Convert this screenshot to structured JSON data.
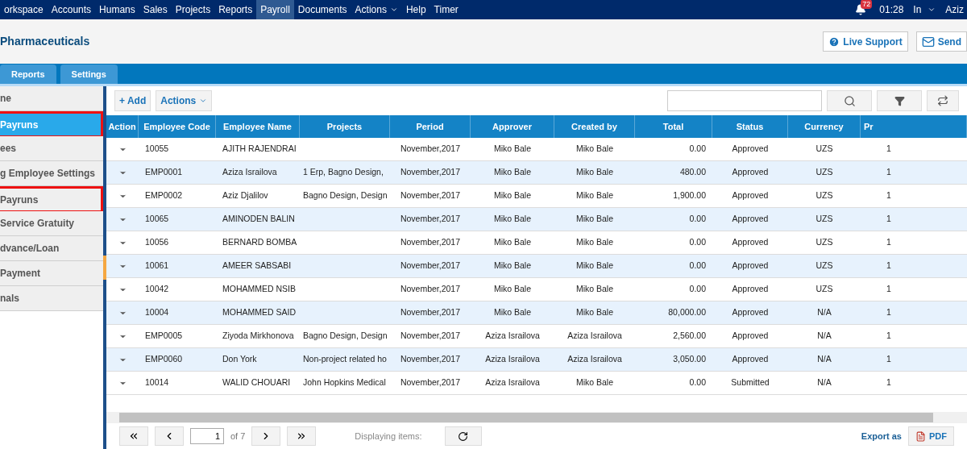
{
  "nav": {
    "items": [
      {
        "label": "orkspace",
        "selected": false
      },
      {
        "label": "Accounts",
        "selected": false
      },
      {
        "label": "Humans",
        "selected": false
      },
      {
        "label": "Sales",
        "selected": false
      },
      {
        "label": "Projects",
        "selected": false
      },
      {
        "label": "Reports",
        "selected": false
      },
      {
        "label": "Payroll",
        "selected": true
      },
      {
        "label": "Documents",
        "selected": false
      },
      {
        "label": "Actions",
        "selected": false,
        "dropdown": true
      },
      {
        "label": "Help",
        "selected": false
      },
      {
        "label": "Timer",
        "selected": false
      }
    ],
    "notification_count": "72",
    "time": "01:28",
    "clock_status": "In",
    "user": "Aziz"
  },
  "header": {
    "title": "Pharmaceuticals",
    "buttons": [
      {
        "kind": "help",
        "label": "Live Support"
      },
      {
        "kind": "mail",
        "label": "Send"
      }
    ]
  },
  "tabs": [
    {
      "label": "Reports"
    },
    {
      "label": "Settings"
    }
  ],
  "sidebar": {
    "items": [
      {
        "label": "ne",
        "selected": false,
        "highlighted": false
      },
      {
        "label": "Payruns",
        "selected": true,
        "highlighted": true
      },
      {
        "label": "ees",
        "selected": false,
        "highlighted": false
      },
      {
        "label": "g Employee Settings",
        "selected": false,
        "highlighted": false
      },
      {
        "label": "Payruns",
        "selected": false,
        "highlighted": true
      },
      {
        "label": "Service Gratuity",
        "selected": false,
        "highlighted": false
      },
      {
        "label": "dvance/Loan",
        "selected": false,
        "highlighted": false
      },
      {
        "label": "Payment",
        "selected": false,
        "highlighted": false
      },
      {
        "label": "nals",
        "selected": false,
        "highlighted": false
      }
    ]
  },
  "toolbar": {
    "add": "+ Add",
    "actions": "Actions"
  },
  "table": {
    "action_header": "Action",
    "columns": [
      "Employee Code",
      "Employee Name",
      "Projects",
      "Period",
      "Approver",
      "Created by",
      "Total",
      "Status",
      "Currency",
      "Pr"
    ],
    "rows": [
      [
        "10055",
        "AJITH RAJENDRAI",
        "",
        "November,2017",
        "Miko Bale",
        "Miko Bale",
        "0.00",
        "Approved",
        "UZS",
        "1"
      ],
      [
        "EMP0001",
        "Aziza Israilova",
        "1 Erp, Bagno Design,",
        "November,2017",
        "Miko Bale",
        "Miko Bale",
        "480.00",
        "Approved",
        "UZS",
        "1"
      ],
      [
        "EMP0002",
        "Aziz Djalilov",
        "Bagno Design, Design",
        "November,2017",
        "Miko Bale",
        "Miko Bale",
        "1,900.00",
        "Approved",
        "UZS",
        "1"
      ],
      [
        "10065",
        "AMINODEN BALIN",
        "",
        "November,2017",
        "Miko Bale",
        "Miko Bale",
        "0.00",
        "Approved",
        "UZS",
        "1"
      ],
      [
        "10056",
        "BERNARD BOMBA",
        "",
        "November,2017",
        "Miko Bale",
        "Miko Bale",
        "0.00",
        "Approved",
        "UZS",
        "1"
      ],
      [
        "10061",
        "AMEER SABSABI",
        "",
        "November,2017",
        "Miko Bale",
        "Miko Bale",
        "0.00",
        "Approved",
        "UZS",
        "1"
      ],
      [
        "10042",
        "MOHAMMED NSIB",
        "",
        "November,2017",
        "Miko Bale",
        "Miko Bale",
        "0.00",
        "Approved",
        "UZS",
        "1"
      ],
      [
        "10004",
        "MOHAMMED SAID",
        "",
        "November,2017",
        "Miko Bale",
        "Miko Bale",
        "80,000.00",
        "Approved",
        "N/A",
        "1"
      ],
      [
        "EMP0005",
        "Ziyoda Mirkhonova",
        "Bagno Design, Design",
        "November,2017",
        "Aziza Israilova",
        "Aziza Israilova",
        "2,560.00",
        "Approved",
        "N/A",
        "1"
      ],
      [
        "EMP0060",
        "Don York",
        "Non-project related ho",
        "November,2017",
        "Aziza Israilova",
        "Aziza Israilova",
        "3,050.00",
        "Approved",
        "N/A",
        "1"
      ],
      [
        "10014",
        "WALID CHOUARI",
        "John Hopkins Medical",
        "November,2017",
        "Aziza Israilova",
        "Miko Bale",
        "0.00",
        "Submitted",
        "N/A",
        "1"
      ]
    ]
  },
  "pager": {
    "page": "1",
    "of": "of 7",
    "displaying": "Displaying items:",
    "export_label": "Export as",
    "export_button": "PDF"
  }
}
